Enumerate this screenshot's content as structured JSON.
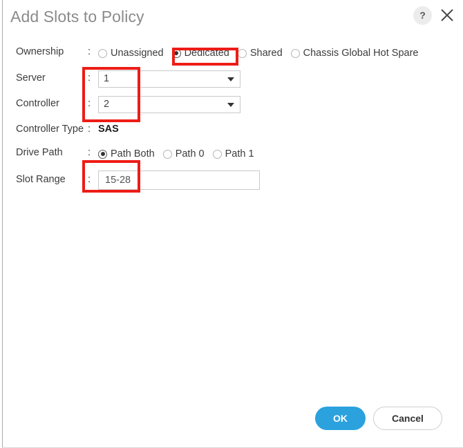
{
  "dialog": {
    "title": "Add Slots to Policy",
    "help_icon": "question-mark-icon",
    "help_label": "?",
    "close_icon": "close-icon"
  },
  "form": {
    "rows": [
      {
        "label": "Ownership",
        "separator": ":",
        "type": "radio-group",
        "options": [
          {
            "label": "Unassigned",
            "selected": false
          },
          {
            "label": "Dedicated",
            "selected": true
          },
          {
            "label": "Shared",
            "selected": false
          },
          {
            "label": "Chassis Global Hot Spare",
            "selected": false
          }
        ]
      },
      {
        "label": "Server",
        "separator": ":",
        "type": "select",
        "value": "1"
      },
      {
        "label": "Controller",
        "separator": ":",
        "type": "select",
        "value": "2"
      },
      {
        "label": "Controller Type",
        "separator": ":",
        "type": "static",
        "value": "SAS"
      },
      {
        "label": "Drive Path",
        "separator": ":",
        "type": "radio-group",
        "options": [
          {
            "label": "Path Both",
            "selected": true
          },
          {
            "label": "Path 0",
            "selected": false
          },
          {
            "label": "Path 1",
            "selected": false
          }
        ]
      },
      {
        "label": "Slot Range",
        "separator": ":",
        "type": "text",
        "value": "15-28",
        "placeholder": ""
      }
    ]
  },
  "footer": {
    "ok_label": "OK",
    "cancel_label": "Cancel"
  },
  "colors": {
    "accent_blue": "#2ba2de",
    "annotation_red": "#ee1c16",
    "title_grey": "#8b8b8b",
    "text_grey": "#3b3b3b"
  },
  "annotations": [
    {
      "name": "highlight-dedicated-option"
    },
    {
      "name": "highlight-server-controller-values"
    },
    {
      "name": "highlight-slot-range-value"
    }
  ]
}
